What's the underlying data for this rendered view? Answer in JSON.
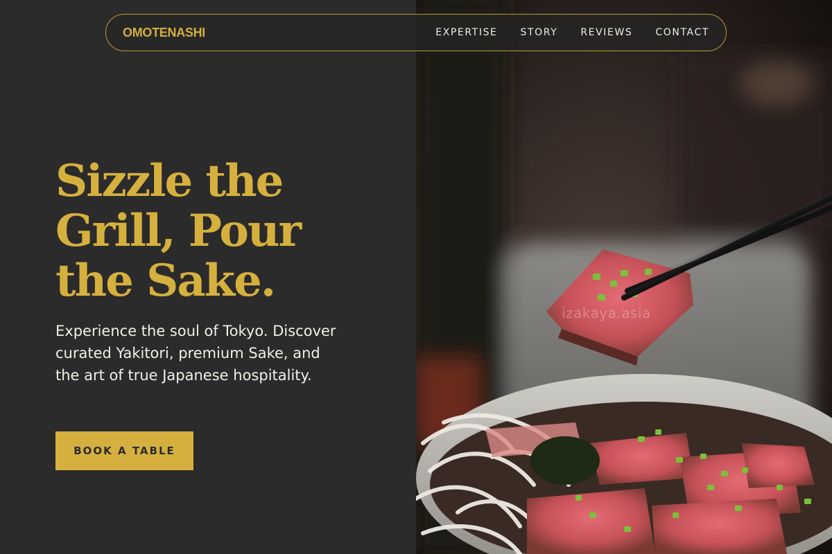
{
  "brand": "OMOTENASHI",
  "nav": {
    "items": [
      {
        "label": "EXPERTISE"
      },
      {
        "label": "STORY"
      },
      {
        "label": "REVIEWS"
      },
      {
        "label": "CONTACT"
      }
    ]
  },
  "hero": {
    "title": "Sizzle the Grill, Pour the Sake.",
    "subtitle": "Experience the soul of Tokyo. Discover curated Yakitori, premium Sake, and the art of true Japanese hospitality.",
    "cta_label": "BOOK A TABLE",
    "image_watermark": "izakaya.asia"
  },
  "colors": {
    "accent": "#d6b03e",
    "background": "#2b2b2b",
    "text_light": "#f2efe8"
  }
}
